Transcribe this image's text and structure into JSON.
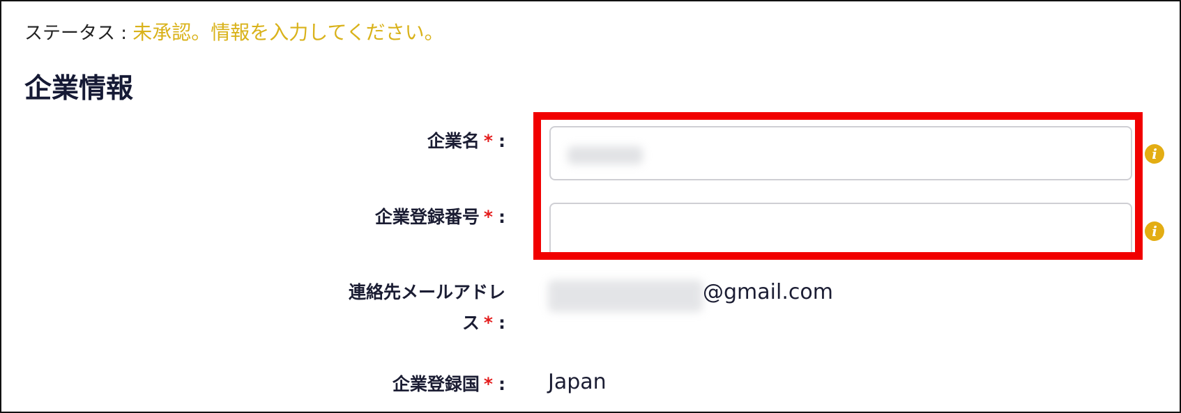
{
  "status": {
    "label": "ステータス :",
    "value": "未承認。情報を入力してください。"
  },
  "section": {
    "title": "企業情報"
  },
  "form": {
    "required_marker": "*",
    "colon": ":",
    "company_name": {
      "label": "企業名",
      "value": ""
    },
    "registration_number": {
      "label": "企業登録番号",
      "value": ""
    },
    "contact_email": {
      "label": "連絡先メールアドレス",
      "value_visible": "@gmail.com"
    },
    "country": {
      "label": "企業登録国",
      "value": "Japan"
    }
  },
  "icons": {
    "info": "info-icon",
    "info_glyph": "i"
  },
  "colors": {
    "status_pending": "#d9b21a",
    "required": "#e41b1b",
    "highlight": "#f10000",
    "info_icon": "#e3ad13"
  }
}
